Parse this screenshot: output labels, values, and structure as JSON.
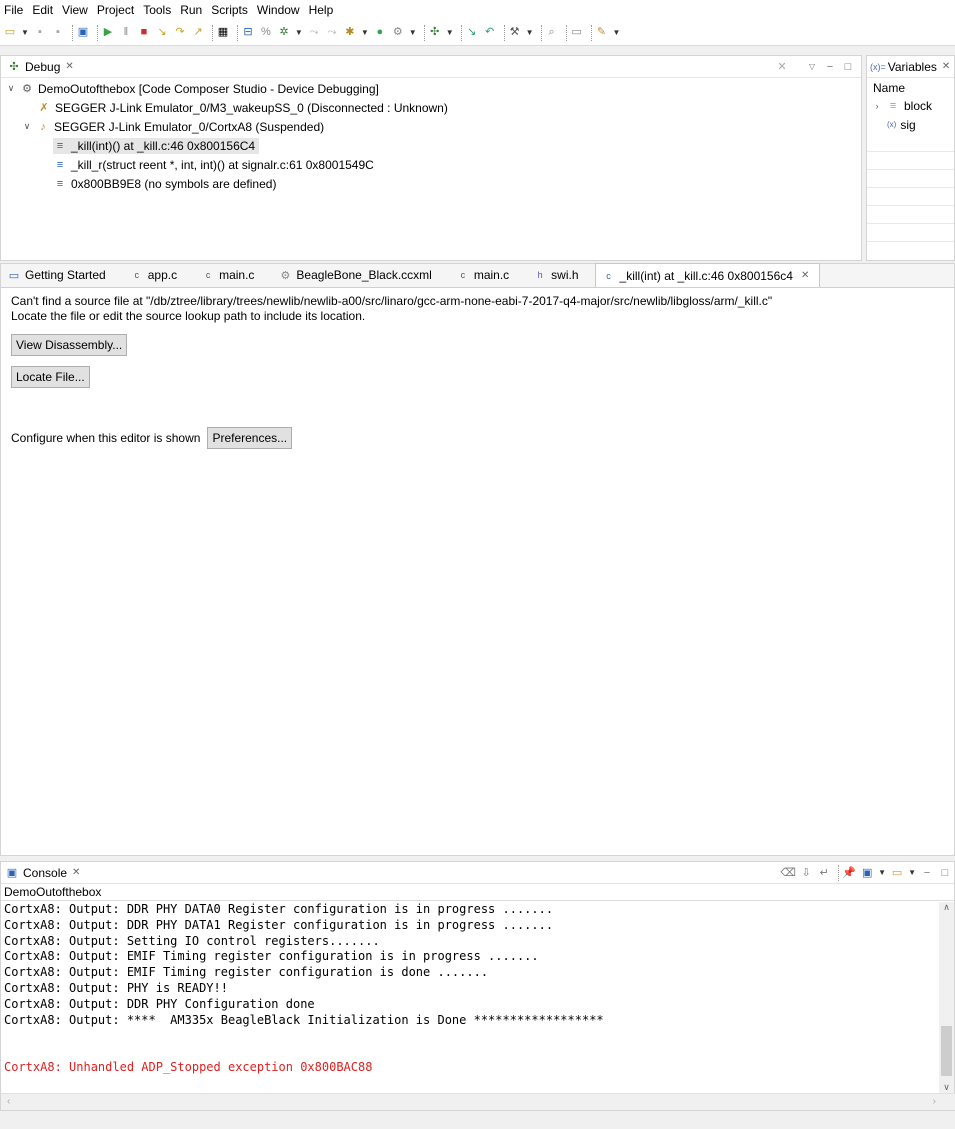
{
  "menu": [
    "File",
    "Edit",
    "View",
    "Project",
    "Tools",
    "Run",
    "Scripts",
    "Window",
    "Help"
  ],
  "debug": {
    "title": "Debug",
    "tree": [
      {
        "label": "DemoOutofthebox [Code Composer Studio - Device Debugging]"
      },
      {
        "label": "SEGGER J-Link Emulator_0/M3_wakeupSS_0 (Disconnected : Unknown)"
      },
      {
        "label": "SEGGER J-Link Emulator_0/CortxA8 (Suspended)"
      },
      {
        "label": "_kill(int)() at _kill.c:46 0x800156C4"
      },
      {
        "label": "_kill_r(struct reent *, int, int)() at signalr.c:61 0x8001549C"
      },
      {
        "label": "0x800BB9E8  (no symbols are defined)"
      }
    ]
  },
  "variables": {
    "title": "Variables",
    "column": "Name",
    "items": [
      "block",
      "sig"
    ]
  },
  "editor": {
    "tabs": [
      "Getting Started",
      "app.c",
      "main.c",
      "BeagleBone_Black.ccxml",
      "main.c",
      "swi.h",
      "_kill(int) at _kill.c:46 0x800156c4"
    ],
    "message1": "Can't find a source file at \"/db/ztree/library/trees/newlib/newlib-a00/src/linaro/gcc-arm-none-eabi-7-2017-q4-major/src/newlib/libgloss/arm/_kill.c\"",
    "message2": "Locate the file or edit the source lookup path to include its location.",
    "view_disassembly": "View Disassembly...",
    "locate_file": "Locate File...",
    "configure_text": "Configure when this editor is shown",
    "preferences": "Preferences..."
  },
  "console": {
    "title": "Console",
    "label": "DemoOutofthebox",
    "lines": [
      "CortxA8: Output: DDR PHY DATA0 Register configuration is in progress .......",
      "CortxA8: Output: DDR PHY DATA1 Register configuration is in progress .......",
      "CortxA8: Output: Setting IO control registers.......",
      "CortxA8: Output: EMIF Timing register configuration is in progress .......",
      "CortxA8: Output: EMIF Timing register configuration is done .......",
      "CortxA8: Output: PHY is READY!!",
      "CortxA8: Output: DDR PHY Configuration done",
      "CortxA8: Output: ****  AM335x BeagleBlack Initialization is Done ******************",
      "",
      "",
      "CortxA8: Unhandled ADP_Stopped exception 0x800BAC88"
    ],
    "error_color": "#e02020"
  }
}
